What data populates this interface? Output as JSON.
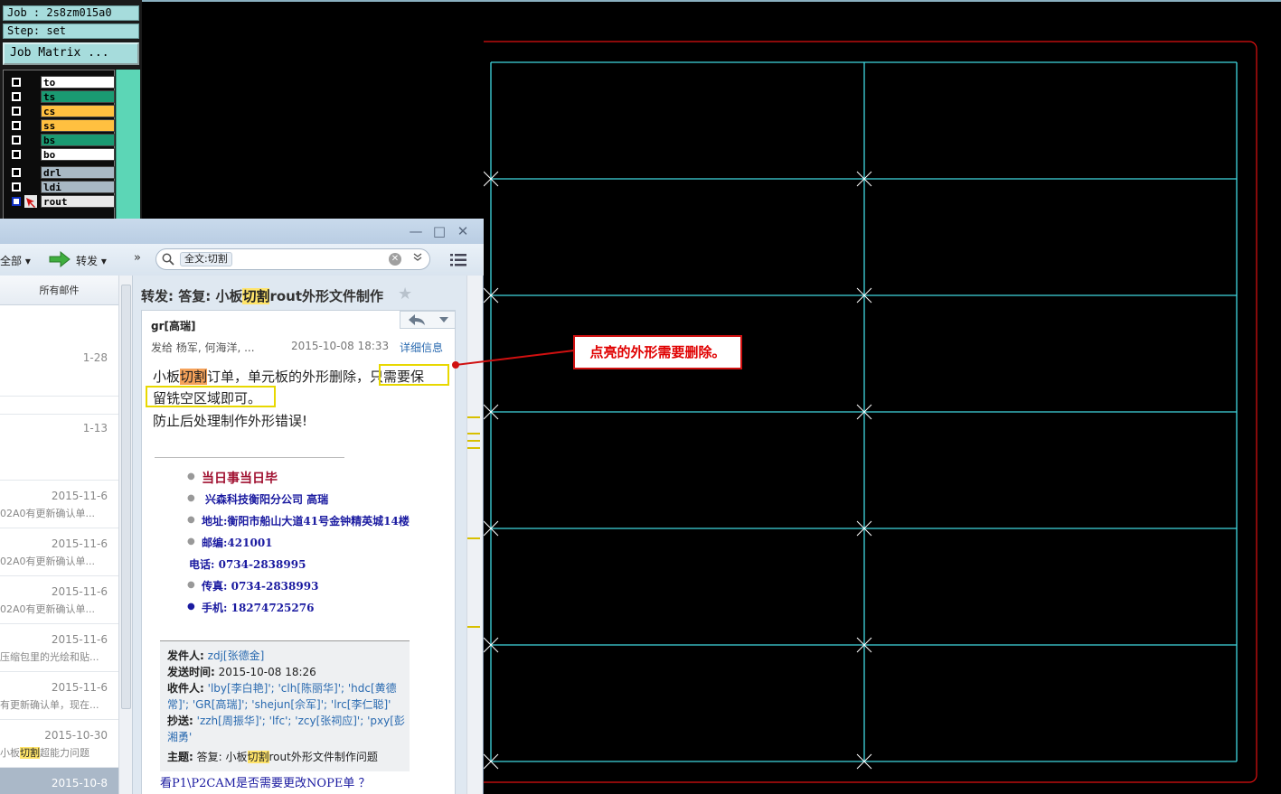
{
  "cam": {
    "job": "Job : 2s8zm015a0",
    "step": "Step: set",
    "job_matrix_button": "Job Matrix ...",
    "layers": [
      {
        "name": "to",
        "color": "#ffffff"
      },
      {
        "name": "ts",
        "color": "#1a9a72"
      },
      {
        "name": "cs",
        "color": "#ffc040"
      },
      {
        "name": "ss",
        "color": "#ffc040"
      },
      {
        "name": "bs",
        "color": "#1a9a72"
      },
      {
        "name": "bo",
        "color": "#ffffff"
      },
      {
        "name": "drl",
        "color": "#a8b8c4"
      },
      {
        "name": "ldi",
        "color": "#a8b8c4"
      },
      {
        "name": "rout",
        "color": "#e8e8e8"
      }
    ],
    "profile_color": "#e01010",
    "grid_color": "#40d8e0",
    "accent_color": "#5cd6b6"
  },
  "mail": {
    "window_controls": {
      "minimize": "—",
      "maximize": "□",
      "close": "✕"
    },
    "toolbar": {
      "all": "全部 ▾",
      "forward": "转发 ▾",
      "more": "»",
      "search_chip": "全文:切割",
      "search_clear": "✕",
      "search_dropdown": "❯❯"
    },
    "list": {
      "header": "所有邮件",
      "items": [
        {
          "date": "1-28",
          "snippet": ""
        },
        {
          "date": "1-13",
          "snippet": ""
        },
        {
          "date": "2015-11-6",
          "snippet": "02A0有更新确认单..."
        },
        {
          "date": "2015-11-6",
          "snippet": "02A0有更新确认单..."
        },
        {
          "date": "2015-11-6",
          "snippet": "02A0有更新确认单..."
        },
        {
          "date": "2015-11-6",
          "snippet": "压缩包里的光绘和贴..."
        },
        {
          "date": "2015-11-6",
          "snippet": "有更新确认单，现在..."
        },
        {
          "date": "2015-10-30",
          "snippet_pre": "小板",
          "snippet_hl": "切割",
          "snippet_post": "超能力问题"
        },
        {
          "date": "2015-10-8",
          "snippet": ""
        }
      ]
    },
    "reading": {
      "subject_pre": "转发: 答复: 小板",
      "subject_hl": "切割",
      "subject_post": "rout外形文件制作",
      "star": "★",
      "sender": "gr[高瑞]",
      "recipients": "发给 杨军, 何海洋, ...",
      "date": "2015-10-08 18:33",
      "detail_link": "详细信息",
      "body": {
        "line1_pre": "小板",
        "line1_hl": "切割",
        "line1_mid": "订单，单元板的外形删除，",
        "line1_box": "只需要保",
        "line2": "留铣空区域即可。",
        "line3": "防止后处理制作外形错误!"
      },
      "signature": {
        "motto": "当日事当日毕",
        "company": "兴森科技衡阳分公司    高瑞",
        "address": "地址:衡阳市船山大道41号金钟精英城14楼",
        "postcode": "邮编:421001",
        "phone": "电话: 0734-2838995",
        "fax": "传真: 0734-2838993",
        "mobile": "手机: 18274725276"
      },
      "quote": {
        "from_label": "发件人:",
        "from": "zdj[张德金]",
        "sent_label": "发送时间:",
        "sent": "2015-10-08 18:26",
        "to_label": "收件人:",
        "to_line1": "'lby[李白艳]'; 'clh[陈丽华]'; 'hdc[黄德",
        "to_line2": "常]'; 'GR[高瑞]'; 'shejun[佘军]'; 'lrc[李仁聪]'",
        "cc_label": "抄送:",
        "cc_line1": "'zzh[周振华]'; 'lfc'; 'zcy[张祠应]'; 'pxy[彭",
        "cc_line2": "湘勇'",
        "subject_label": "主题:",
        "subject_pre": "答复: 小板",
        "subject_hl": "切割",
        "subject_post": "rout外形文件制作问题"
      },
      "bottom_line": "看P1\\P2CAM是否需要更改NOPE单 ？"
    }
  },
  "callout": {
    "text": "点亮的外形需要删除。"
  }
}
